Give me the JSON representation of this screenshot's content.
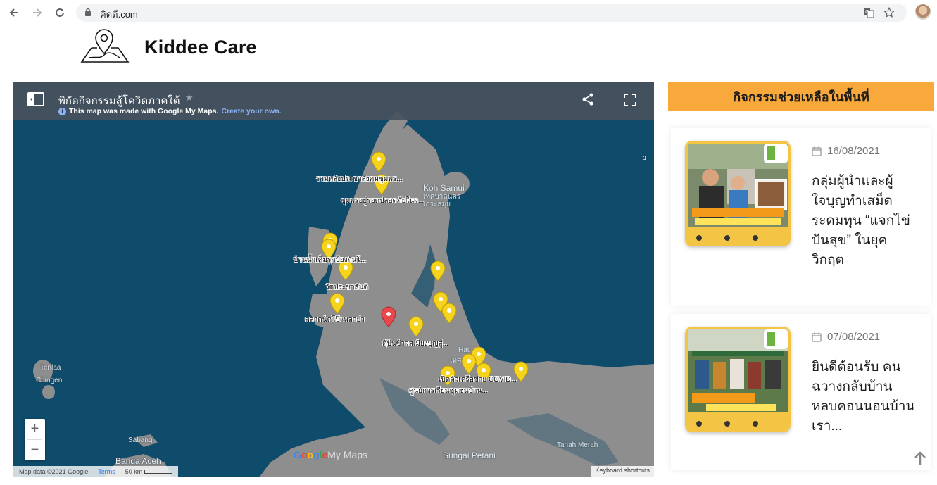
{
  "browser": {
    "url": "คิดดี.com"
  },
  "site": {
    "title": "Kiddee Care"
  },
  "map": {
    "title": "พิกัดกิจกรรมสู้โควิดภาคใต้",
    "subtitle": "This map was made with Google My Maps.",
    "create_link": "Create your own.",
    "pins": [
      {
        "label": "รวมพลังประชาสังคมชุมพร..."
      },
      {
        "label": "ชุมพรอยู่รอดปลอดภัยในว..."
      },
      {
        "label": "บ้านน้ำเค็มรุกป้องกันโ..."
      },
      {
        "label": "วัดประชาสันติ"
      },
      {
        "label": "ตลาดนัดโป๊ะพลาย่า"
      },
      {
        "label": "ตู้ปันข้าวสเมียงบุญสู่..."
      },
      {
        "label": "เปิดตัวเครือข่าย COVID..."
      },
      {
        "label": "ศูนย์การเรียนชุมชนบ้าน..."
      }
    ],
    "places": {
      "koh_samui": "Koh Samui",
      "koh_samui_th": "เทศบาลนคร เกาะสมุย",
      "tenlaa": "Tenlaa",
      "chingen": "Chingen",
      "sabang": "Sabang",
      "banda_aceh": "Banda Aceh",
      "sungai_petani": "Sungai Petani",
      "tanah_merah": "Tanah Merah",
      "hat": "Hat",
      "hat_th": "เทศ",
      "edge": "ย"
    },
    "logo": {
      "g": "G",
      "o1": "o",
      "o2": "o",
      "g2": "g",
      "l": "l",
      "e": "e",
      "mymaps": "My Maps"
    },
    "attribution": "Map data ©2021 Google",
    "terms": "Terms",
    "scale": "50 km",
    "keyboard": "Keyboard shortcuts",
    "zoom_in": "+",
    "zoom_out": "−"
  },
  "sidebar": {
    "header": "กิจกรรมช่วยเหลือในพื้นที่",
    "cards": [
      {
        "date": "16/08/2021",
        "title": "กลุ่มผู้นำและผู้ใจบุญทำเสม็ดระดมทุน “แจกไข่ปันสุข” ในยุควิกฤต"
      },
      {
        "date": "07/08/2021",
        "title": "ยินดีต้อนรับ คนฉวางกลับบ้านหลบคอนนอนบ้านเรา..."
      }
    ]
  },
  "colors": {
    "accent": "#f9a83b",
    "sea": "#0f4b6a",
    "land": "#8e8e8e",
    "pin_yellow": "#f6d31c",
    "pin_red": "#e8474c"
  }
}
